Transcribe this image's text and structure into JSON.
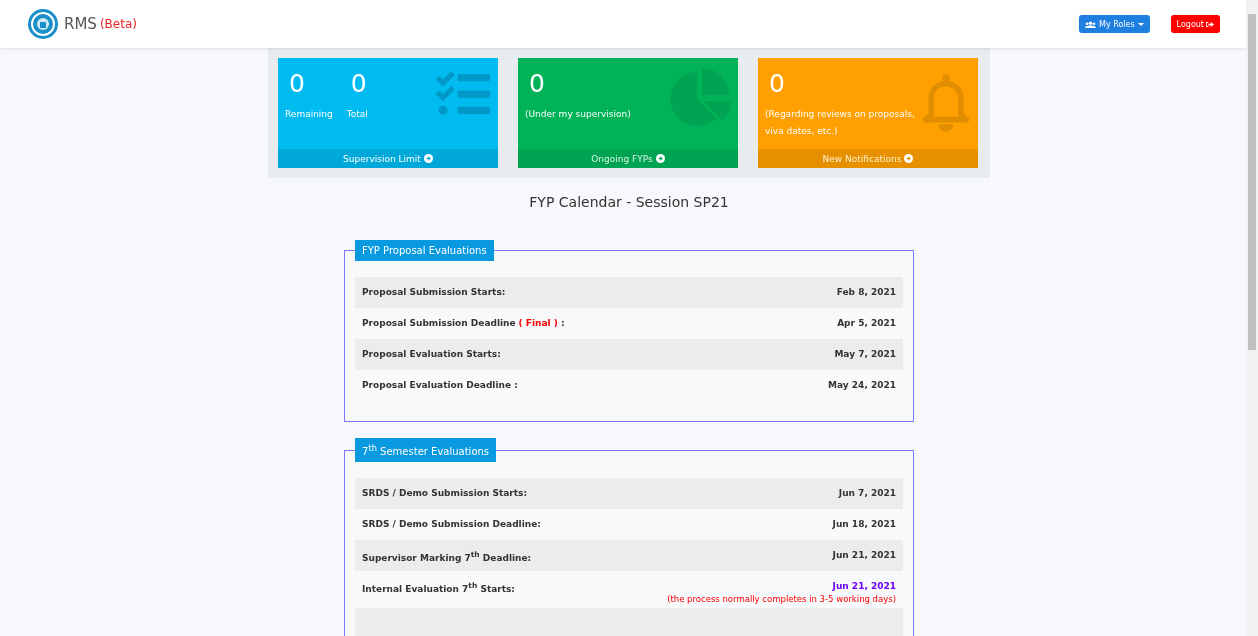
{
  "navbar": {
    "brand": "RMS",
    "badge": "(Beta)",
    "roles_button": "My Roles",
    "logout_button": "Logout"
  },
  "cards": [
    {
      "kind": "limit",
      "stats": [
        {
          "value": "0",
          "label": "Remaining"
        },
        {
          "value": "0",
          "label": "Total"
        }
      ],
      "footer": "Supervision Limit"
    },
    {
      "kind": "ongoing",
      "stats": [
        {
          "value": "0",
          "label": "(Under my supervision)"
        }
      ],
      "footer": "Ongoing FYPs"
    },
    {
      "kind": "notifications",
      "stats": [
        {
          "value": "0",
          "label": "(Regarding reviews on proposals, viva dates, etc.)"
        }
      ],
      "footer": "New Notifications"
    }
  ],
  "calendar_title": "FYP Calendar - Session SP21",
  "sections": [
    {
      "legend": "FYP Proposal Evaluations",
      "more_rows_below": false,
      "rows": [
        {
          "label": "Proposal Submission Starts:",
          "date": "Feb 8, 2021",
          "highlighted": false
        },
        {
          "label": "Proposal Submission Deadline",
          "flag": "( Final )",
          "suffix": ":",
          "date": "Apr 5, 2021",
          "highlighted": false
        },
        {
          "label": "Proposal Evaluation Starts:",
          "date": "May 7, 2021",
          "highlighted": false
        },
        {
          "label": "Proposal Evaluation Deadline :",
          "date": "May 24, 2021",
          "highlighted": false
        }
      ]
    },
    {
      "legend": "7$^{th}$ Semester Evaluations",
      "more_rows_below": true,
      "rows": [
        {
          "label": "SRDS / Demo Submission Starts:",
          "date": "Jun 7, 2021",
          "highlighted": false
        },
        {
          "label": "SRDS / Demo Submission Deadline:",
          "date": "Jun 18, 2021",
          "highlighted": false
        },
        {
          "label": "Supervisor Marking 7$^{th}$ Deadline:",
          "date": "Jun 21, 2021",
          "highlighted": false
        },
        {
          "label": "Internal Evaluation 7$^{th}$ Starts:",
          "date": "Jun 21, 2021",
          "highlighted": true,
          "note": "(the process normally completes in 3-5 working days)"
        }
      ]
    }
  ]
}
